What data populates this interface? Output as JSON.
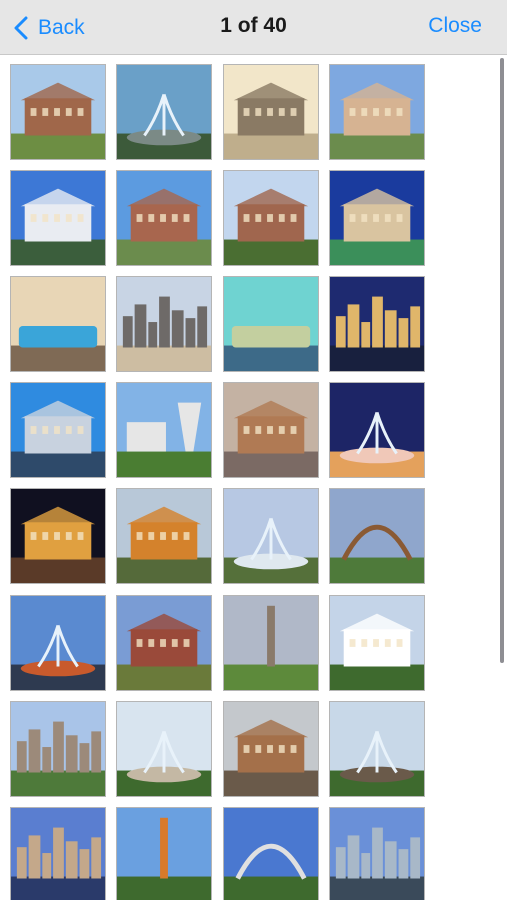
{
  "nav": {
    "back_label": "Back",
    "title": "1 of 40",
    "close_label": "Close"
  },
  "icons": {
    "back": "chevron-left-icon"
  },
  "colors": {
    "accent": "#1a8cff",
    "navbar": "#e6e6e6",
    "title": "#1b1b1b"
  },
  "thumbnails": [
    {
      "subject": "brick-building",
      "palette": [
        "#a9c9e9",
        "#a0674a",
        "#6d8e43"
      ]
    },
    {
      "subject": "fountain",
      "palette": [
        "#6aa0c8",
        "#7b8a86",
        "#3c5a3a"
      ]
    },
    {
      "subject": "ruins",
      "palette": [
        "#f2e6c9",
        "#8a7a64",
        "#bfae8c"
      ]
    },
    {
      "subject": "hotel",
      "palette": [
        "#7ea8e0",
        "#d6b392",
        "#6b8c4d"
      ]
    },
    {
      "subject": "hotel",
      "palette": [
        "#3d78d6",
        "#e9ecf2",
        "#3b5e3c"
      ]
    },
    {
      "subject": "hotel",
      "palette": [
        "#5c9be0",
        "#a8664e",
        "#6b8c4d"
      ]
    },
    {
      "subject": "hotel",
      "palette": [
        "#c2d6ee",
        "#a0664e",
        "#4a6e32"
      ]
    },
    {
      "subject": "hotel",
      "palette": [
        "#1a3b9e",
        "#d9c4a0",
        "#3b8f5a"
      ]
    },
    {
      "subject": "pool",
      "palette": [
        "#e8d6b6",
        "#3aa5d9",
        "#7f6a55"
      ]
    },
    {
      "subject": "skyline",
      "palette": [
        "#c8d4e4",
        "#6e6a68",
        "#cdbda2"
      ]
    },
    {
      "subject": "lazy-river",
      "palette": [
        "#6fd3d1",
        "#c3cf9f",
        "#3d6a88"
      ]
    },
    {
      "subject": "night-skyline",
      "palette": [
        "#1e2a70",
        "#e0b66a",
        "#18203e"
      ]
    },
    {
      "subject": "museum",
      "palette": [
        "#2f8be0",
        "#c8d2df",
        "#2e4a6a"
      ]
    },
    {
      "subject": "shuttlecock",
      "palette": [
        "#82b3e6",
        "#e6e6e6",
        "#4a7d32"
      ]
    },
    {
      "subject": "plaza",
      "palette": [
        "#c4b2a3",
        "#b07a54",
        "#7b6a64"
      ]
    },
    {
      "subject": "fountain",
      "palette": [
        "#1d2566",
        "#f0c8b8",
        "#e4a15c"
      ]
    },
    {
      "subject": "night-plaza",
      "palette": [
        "#101020",
        "#e0a040",
        "#5a3a28"
      ]
    },
    {
      "subject": "autumn-town",
      "palette": [
        "#b8c8d8",
        "#d4822c",
        "#556a3a"
      ]
    },
    {
      "subject": "fountain",
      "palette": [
        "#b7c8e3",
        "#dfe8ef",
        "#55703a"
      ]
    },
    {
      "subject": "sign",
      "palette": [
        "#8fa6cc",
        "#8a5a34",
        "#4e7a3a"
      ]
    },
    {
      "subject": "fountain",
      "palette": [
        "#5a8ad0",
        "#c85a2c",
        "#2e3a50"
      ]
    },
    {
      "subject": "brick-street",
      "palette": [
        "#7a9cd4",
        "#9a4a3a",
        "#6a7a3a"
      ]
    },
    {
      "subject": "monument",
      "palette": [
        "#b0b8c8",
        "#8a7a6a",
        "#5d8a3b"
      ]
    },
    {
      "subject": "house",
      "palette": [
        "#c4d4e8",
        "#ffffff",
        "#3e6a2e"
      ]
    },
    {
      "subject": "skyline",
      "palette": [
        "#a9c4e8",
        "#9c8a7a",
        "#4e7a3a"
      ]
    },
    {
      "subject": "fountain",
      "palette": [
        "#d8e4ef",
        "#c4b8a4",
        "#3e6a2e"
      ]
    },
    {
      "subject": "station",
      "palette": [
        "#c4c8cc",
        "#a4704a",
        "#6a5a4a"
      ]
    },
    {
      "subject": "fountain",
      "palette": [
        "#c8d8e8",
        "#6a5a4a",
        "#3e6a2e"
      ]
    },
    {
      "subject": "skyline",
      "palette": [
        "#5a7ed0",
        "#c4a88a",
        "#2a3a6a"
      ]
    },
    {
      "subject": "monument",
      "palette": [
        "#6aa0e0",
        "#d87a2a",
        "#3e6a2e"
      ]
    },
    {
      "subject": "arch",
      "palette": [
        "#4a78d0",
        "#e0e0e0",
        "#3e6a2e"
      ]
    },
    {
      "subject": "skyline",
      "palette": [
        "#6a90d8",
        "#a8b8c8",
        "#3a4a5a"
      ]
    }
  ]
}
